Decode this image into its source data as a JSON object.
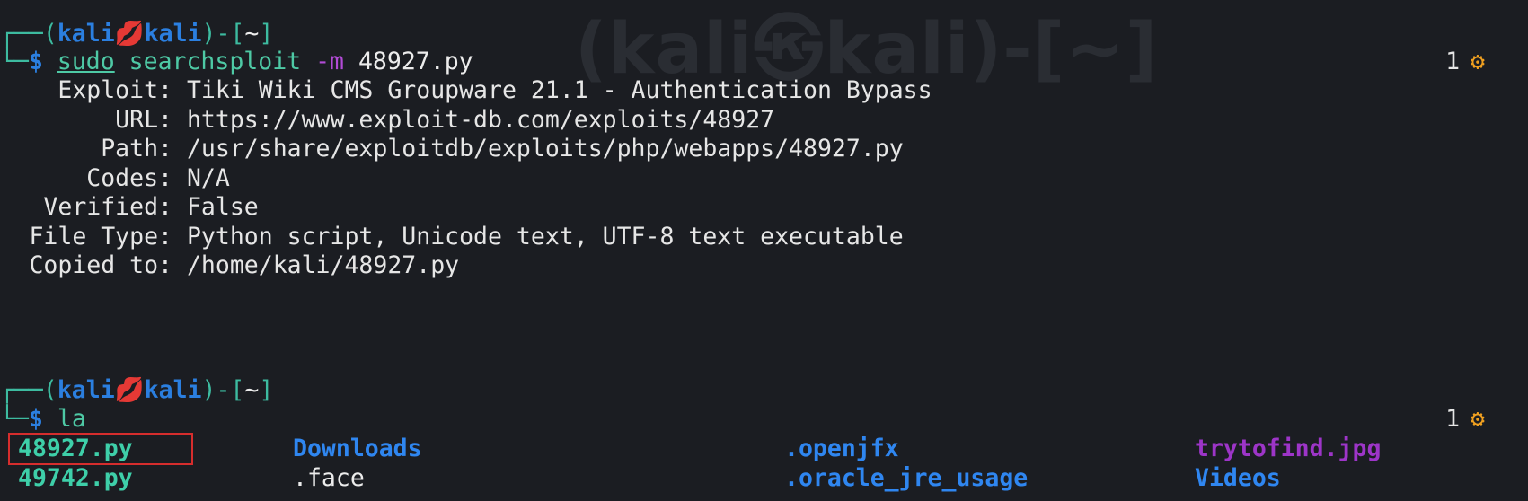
{
  "watermark": "(kali㉿kali)-[~]",
  "prompt": {
    "user": "kali",
    "host": "kali",
    "at_symbol": "💋",
    "dir": "~",
    "dollar": "$"
  },
  "commands": {
    "first": {
      "sudo": "sudo",
      "tool": "searchsploit",
      "flag": "-m",
      "arg": "48927.py"
    },
    "second": "la"
  },
  "right_prompt": {
    "jobs": "1",
    "icon": "gear-icon"
  },
  "exploit_info": [
    {
      "label": "Exploit:",
      "value": "Tiki Wiki CMS Groupware 21.1 - Authentication Bypass"
    },
    {
      "label": "URL:",
      "value": "https://www.exploit-db.com/exploits/48927"
    },
    {
      "label": "Path:",
      "value": "/usr/share/exploitdb/exploits/php/webapps/48927.py"
    },
    {
      "label": "Codes:",
      "value": "N/A"
    },
    {
      "label": "Verified:",
      "value": "False"
    },
    {
      "label": "File Type:",
      "value": "Python script, Unicode text, UTF-8 text executable"
    },
    {
      "label": "Copied to:",
      "value": "/home/kali/48927.py"
    }
  ],
  "listing": {
    "row1": [
      "48927.py",
      "Downloads",
      ".openjfx",
      "trytofind.jpg"
    ],
    "row2": [
      "49742.py",
      ".face",
      ".oracle_jre_usage",
      "Videos"
    ]
  },
  "colors": {
    "background": "#1b1d22",
    "prompt_user": "#2b7fe0",
    "prompt_bracket": "#3dbba0",
    "executable": "#3ecfa9",
    "directory": "#2f86f0",
    "image_file": "#9d35c8",
    "highlight_box": "#d62d2d",
    "gear": "#f0a020"
  }
}
